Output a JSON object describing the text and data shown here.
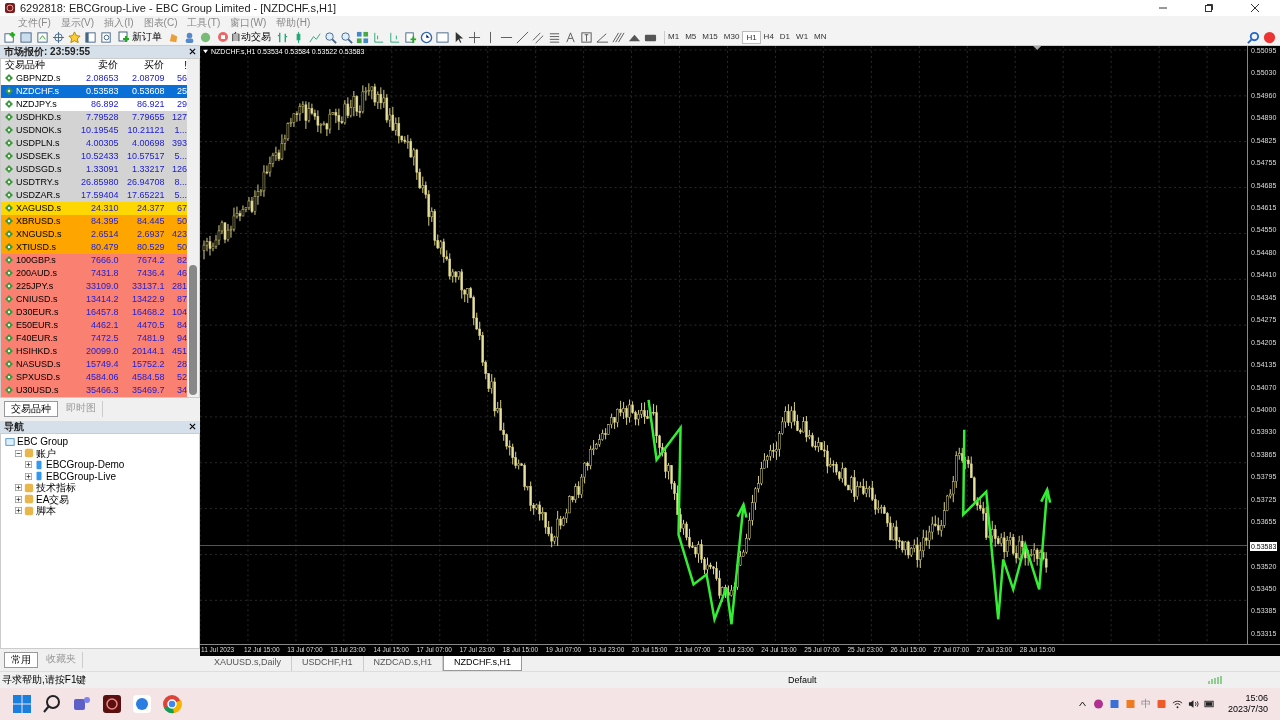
{
  "window": {
    "title": "6292818: EBCGroup-Live - EBC Group Limited - [NZDCHF.s,H1]"
  },
  "menu": [
    "文件(F)",
    "显示(V)",
    "插入(I)",
    "图表(C)",
    "工具(T)",
    "窗口(W)",
    "帮助(H)"
  ],
  "toolbar": {
    "buttons": [
      "新订单",
      "自动交易"
    ],
    "timeframes": [
      {
        "label": "M1",
        "selected": false
      },
      {
        "label": "M5",
        "selected": false
      },
      {
        "label": "M15",
        "selected": false
      },
      {
        "label": "M30",
        "selected": false
      },
      {
        "label": "H1",
        "selected": true
      },
      {
        "label": "H4",
        "selected": false
      },
      {
        "label": "D1",
        "selected": false
      },
      {
        "label": "W1",
        "selected": false
      },
      {
        "label": "MN",
        "selected": false
      }
    ]
  },
  "market_watch": {
    "title": "市场报价: 23:59:55",
    "columns": [
      "交易品种",
      "卖价",
      "买价",
      "!"
    ],
    "rows": [
      {
        "symbol": "GBPNZD.s",
        "bid": "2.08653",
        "ask": "2.08709",
        "spread": "56",
        "color": "#ffffff",
        "selected": false
      },
      {
        "symbol": "NZDCHF.s",
        "bid": "0.53583",
        "ask": "0.53608",
        "spread": "25",
        "selected": true
      },
      {
        "symbol": "NZDJPY.s",
        "bid": "86.892",
        "ask": "86.921",
        "spread": "29",
        "color": "#ffffff",
        "selected": false
      },
      {
        "symbol": "USDHKD.s",
        "bid": "7.79528",
        "ask": "7.79655",
        "spread": "127",
        "color": "#d3d3d3",
        "selected": false
      },
      {
        "symbol": "USDNOK.s",
        "bid": "10.19545",
        "ask": "10.21121",
        "spread": "1...",
        "color": "#d3d3d3",
        "selected": false
      },
      {
        "symbol": "USDPLN.s",
        "bid": "4.00305",
        "ask": "4.00698",
        "spread": "393",
        "color": "#d3d3d3",
        "selected": false
      },
      {
        "symbol": "USDSEK.s",
        "bid": "10.52433",
        "ask": "10.57517",
        "spread": "5...",
        "color": "#d3d3d3",
        "selected": false
      },
      {
        "symbol": "USDSGD.s",
        "bid": "1.33091",
        "ask": "1.33217",
        "spread": "126",
        "color": "#d3d3d3",
        "selected": false
      },
      {
        "symbol": "USDTRY.s",
        "bid": "26.85980",
        "ask": "26.94708",
        "spread": "8...",
        "color": "#d3d3d3",
        "selected": false
      },
      {
        "symbol": "USDZAR.s",
        "bid": "17.59404",
        "ask": "17.65221",
        "spread": "5...",
        "color": "#d3d3d3",
        "selected": false
      },
      {
        "symbol": "XAGUSD.s",
        "bid": "24.310",
        "ask": "24.377",
        "spread": "67",
        "color": "#ffd700",
        "selected": false
      },
      {
        "symbol": "XBRUSD.s",
        "bid": "84.395",
        "ask": "84.445",
        "spread": "50",
        "color": "#ffa500",
        "selected": false
      },
      {
        "symbol": "XNGUSD.s",
        "bid": "2.6514",
        "ask": "2.6937",
        "spread": "423",
        "color": "#ffa500",
        "selected": false
      },
      {
        "symbol": "XTIUSD.s",
        "bid": "80.479",
        "ask": "80.529",
        "spread": "50",
        "color": "#ffa500",
        "selected": false
      },
      {
        "symbol": "100GBP.s",
        "bid": "7666.0",
        "ask": "7674.2",
        "spread": "82",
        "color": "#fa8072",
        "selected": false
      },
      {
        "symbol": "200AUD.s",
        "bid": "7431.8",
        "ask": "7436.4",
        "spread": "46",
        "color": "#fa8072",
        "selected": false
      },
      {
        "symbol": "225JPY.s",
        "bid": "33109.0",
        "ask": "33137.1",
        "spread": "281",
        "color": "#fa8072",
        "selected": false
      },
      {
        "symbol": "CNIUSD.s",
        "bid": "13414.2",
        "ask": "13422.9",
        "spread": "87",
        "color": "#fa8072",
        "selected": false
      },
      {
        "symbol": "D30EUR.s",
        "bid": "16457.8",
        "ask": "16468.2",
        "spread": "104",
        "color": "#fa8072",
        "selected": false
      },
      {
        "symbol": "E50EUR.s",
        "bid": "4462.1",
        "ask": "4470.5",
        "spread": "84",
        "color": "#fa8072",
        "selected": false
      },
      {
        "symbol": "F40EUR.s",
        "bid": "7472.5",
        "ask": "7481.9",
        "spread": "94",
        "color": "#fa8072",
        "selected": false
      },
      {
        "symbol": "HSIHKD.s",
        "bid": "20099.0",
        "ask": "20144.1",
        "spread": "451",
        "color": "#fa8072",
        "selected": false
      },
      {
        "symbol": "NASUSD.s",
        "bid": "15749.4",
        "ask": "15752.2",
        "spread": "28",
        "color": "#fa8072",
        "selected": false
      },
      {
        "symbol": "SPXUSD.s",
        "bid": "4584.06",
        "ask": "4584.58",
        "spread": "52",
        "color": "#fa8072",
        "selected": false
      },
      {
        "symbol": "U30USD.s",
        "bid": "35466.3",
        "ask": "35469.7",
        "spread": "34",
        "color": "#fa8072",
        "selected": false
      }
    ],
    "tabs": [
      {
        "label": "交易品种",
        "selected": true
      },
      {
        "label": "即时图",
        "selected": false
      }
    ]
  },
  "navigator": {
    "title": "导航",
    "tree": [
      {
        "label": "EBC Group",
        "children": [
          {
            "label": "账户",
            "expanded": true,
            "children": [
              {
                "label": "EBCGroup-Demo",
                "expanded": false
              },
              {
                "label": "EBCGroup-Live",
                "expanded": false
              }
            ]
          },
          {
            "label": "技术指标",
            "expanded": false
          },
          {
            "label": "EA交易",
            "expanded": false
          },
          {
            "label": "脚本",
            "expanded": false
          }
        ]
      }
    ],
    "tabs": [
      {
        "label": "常用",
        "selected": true
      },
      {
        "label": "收藏夹",
        "selected": false
      }
    ]
  },
  "chart": {
    "info": "NZDCHF.s,H1  0.53534 0.53584 0.53522 0.53583",
    "current_price": "0.53583",
    "price_labels": [
      "0.55095",
      "0.55030",
      "0.54960",
      "0.54890",
      "0.54825",
      "0.54755",
      "0.54685",
      "0.54615",
      "0.54550",
      "0.54480",
      "0.54410",
      "0.54345",
      "0.54275",
      "0.54205",
      "0.54135",
      "0.54070",
      "0.54000",
      "0.53930",
      "0.53865",
      "0.53795",
      "0.53725",
      "0.53655",
      "0.53520",
      "0.53450",
      "0.53385",
      "0.53315"
    ],
    "time_labels": [
      "11 Jul 2023",
      "12 Jul 15:00",
      "13 Jul 07:00",
      "13 Jul 23:00",
      "14 Jul 15:00",
      "17 Jul 07:00",
      "17 Jul 23:00",
      "18 Jul 15:00",
      "19 Jul 07:00",
      "19 Jul 23:00",
      "20 Jul 15:00",
      "21 Jul 07:00",
      "21 Jul 23:00",
      "24 Jul 15:00",
      "25 Jul 07:00",
      "25 Jul 23:00",
      "26 Jul 15:00",
      "27 Jul 07:00",
      "27 Jul 23:00",
      "28 Jul 15:00"
    ],
    "tabs": [
      {
        "label": "XAUUSD.s,Daily",
        "selected": false
      },
      {
        "label": "USDCHF,H1",
        "selected": false
      },
      {
        "label": "NZDCAD.s,H1",
        "selected": false
      },
      {
        "label": "NZDCHF.s,H1",
        "selected": true
      }
    ]
  },
  "status_bar": {
    "help": "寻求帮助,请按F1键",
    "profile": "Default"
  },
  "taskbar": {
    "ime": "中",
    "time": "15:06",
    "date": "2023/7/30"
  }
}
